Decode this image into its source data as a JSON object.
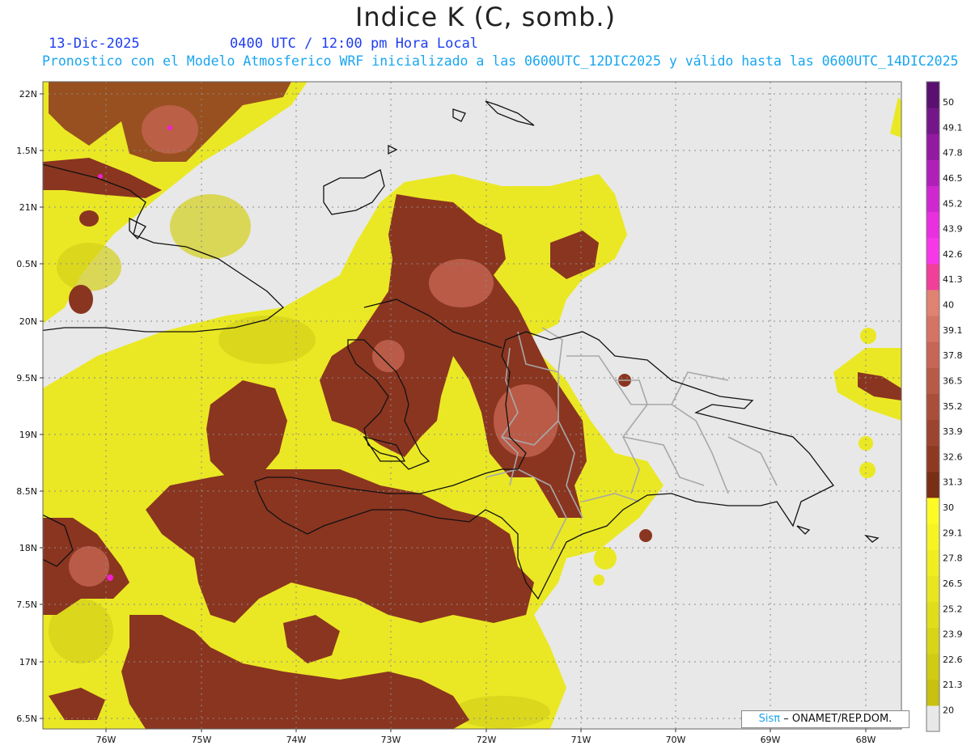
{
  "header": {
    "title": "Indice K (C, somb.)",
    "date": "13-Dic-2025",
    "time": "0400 UTC / 12:00 pm Hora Local",
    "description": "Pronostico con el Modelo Atmosferico WRF inicializado a las 0600UTC_12DIC2025 y válido hasta las  0600UTC_14DIC2025"
  },
  "credit": {
    "logo": "Sisπ",
    "text": "– ONAMET/REP.DOM."
  },
  "axes": {
    "lon_labels": [
      "76W",
      "75W",
      "74W",
      "73W",
      "72W",
      "71W",
      "70W",
      "69W",
      "68W"
    ],
    "lat_labels": [
      "22N",
      "1.5N",
      "21N",
      "0.5N",
      "20N",
      "9.5N",
      "19N",
      "8.5N",
      "18N",
      "7.5N",
      "17N",
      "6.5N"
    ]
  },
  "colorbar": {
    "labels": [
      "50",
      "49.1",
      "47.8",
      "46.5",
      "45.2",
      "43.9",
      "42.6",
      "41.3",
      "40",
      "39.1",
      "37.8",
      "36.5",
      "35.2",
      "33.9",
      "32.6",
      "31.3",
      "30",
      "29.1",
      "27.8",
      "26.5",
      "25.2",
      "23.9",
      "22.6",
      "21.3",
      "20"
    ],
    "colors": [
      "#e8e8e8",
      "#c8c010",
      "#d0cb14",
      "#d8d518",
      "#e0de1c",
      "#e8e620",
      "#f0ee22",
      "#f6f424",
      "#fdfb26",
      "#7a2e14",
      "#8e3a22",
      "#9c4430",
      "#aa4e3c",
      "#b85a48",
      "#c66656",
      "#d47464",
      "#e08272",
      "#f0409a",
      "#f838e8",
      "#e830e0",
      "#d028d0",
      "#b020b8",
      "#921aa0",
      "#74168a",
      "#5a1070"
    ],
    "ranges": {
      "background": "<20",
      "yellow": "20-30",
      "brown": "30-40",
      "magenta": "40-50"
    }
  },
  "colors": {
    "background": "#e8e8e8",
    "coast": "#111111",
    "border": "#a8a8a8",
    "grid": "#888888"
  }
}
